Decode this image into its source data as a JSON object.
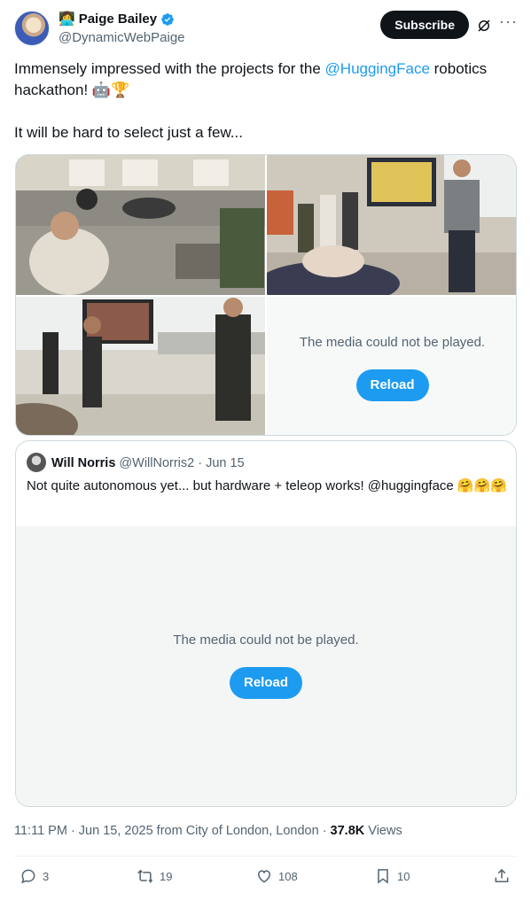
{
  "author": {
    "emoji": "👩‍💻",
    "display_name": "Paige Bailey",
    "handle": "@DynamicWebPaige"
  },
  "header": {
    "subscribe_label": "Subscribe",
    "icons": [
      "grok-icon",
      "more-icon"
    ]
  },
  "tweet": {
    "text_before_mention": "Immensely impressed with the projects for the ",
    "mention": "@HuggingFace",
    "text_after_mention": " robotics hackathon! 🤖🏆",
    "second_paragraph": "It will be hard to select just a few..."
  },
  "media": {
    "error_message": "The media could not be played.",
    "reload_label": "Reload"
  },
  "quote": {
    "name": "Will Norris",
    "meta": "@WillNorris2 · Jun 15",
    "text": "Not quite autonomous yet... but hardware + teleop works! @huggingface 🤗🤗🤗",
    "error_message": "The media could not be played.",
    "reload_label": "Reload"
  },
  "footer": {
    "timestamp": "11:11 PM · Jun 15, 2025 from City of London, London · ",
    "views_count": "37.8K",
    "views_label": " Views"
  },
  "actions": {
    "replies": "3",
    "reposts": "19",
    "likes": "108",
    "bookmarks": "10"
  },
  "colors": {
    "accent": "#1d9bf0",
    "text": "#0f1419",
    "secondary": "#536471",
    "border": "#cfd9de"
  }
}
